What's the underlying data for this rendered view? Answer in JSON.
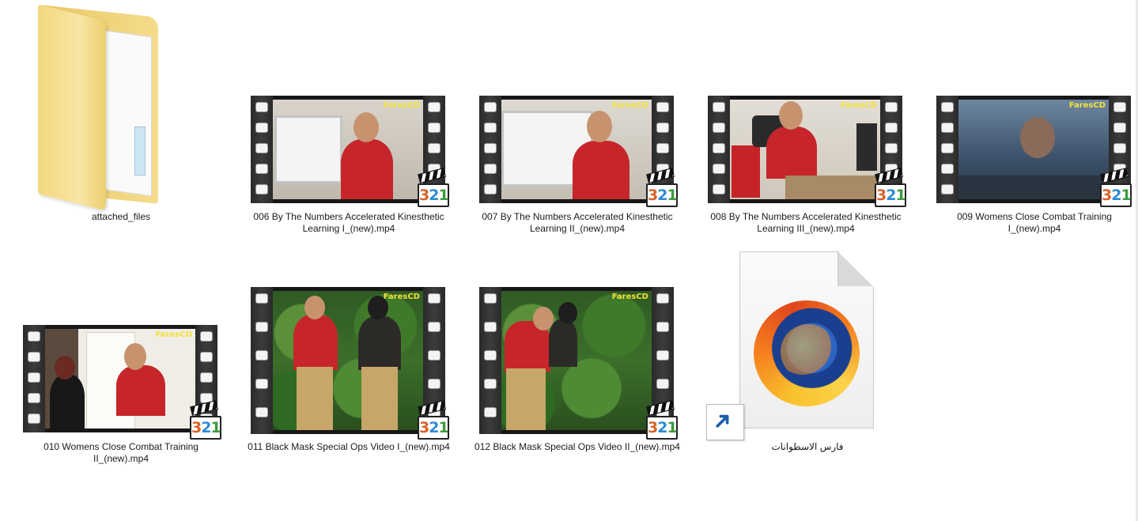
{
  "items": [
    {
      "type": "folder",
      "name": "attached_files"
    },
    {
      "type": "video",
      "name": "006 By The Numbers Accelerated Kinesthetic Learning I_(new).mp4",
      "line1": "006 By The Numbers Accelerated Kinesthetic",
      "line2": "Learning I_(new).mp4"
    },
    {
      "type": "video",
      "name": "007 By The Numbers Accelerated Kinesthetic Learning II_(new).mp4",
      "line1": "007 By The Numbers Accelerated Kinesthetic",
      "line2": "Learning II_(new).mp4"
    },
    {
      "type": "video",
      "name": "008 By The Numbers Accelerated Kinesthetic Learning III_(new).mp4",
      "line1": "008 By The Numbers Accelerated Kinesthetic",
      "line2": "Learning III_(new).mp4"
    },
    {
      "type": "video",
      "name": "009 Womens Close Combat Training I_(new).mp4",
      "line1": "009 Womens Close Combat Training",
      "line2": "I_(new).mp4"
    },
    {
      "type": "video",
      "name": "010 Womens Close Combat Training II_(new).mp4",
      "line1": "010 Womens Close Combat Training",
      "line2": "II_(new).mp4"
    },
    {
      "type": "video",
      "name": "011 Black Mask Special Ops Video I_(new).mp4",
      "line1": "011 Black Mask Special Ops Video I_(new).mp4"
    },
    {
      "type": "video",
      "name": "012 Black Mask Special Ops Video II_(new).mp4",
      "line1": "012 Black Mask Special Ops Video II_(new).mp4"
    },
    {
      "type": "shortcut",
      "name": "فارس الاسطوانات",
      "icon": "firefox-icon"
    }
  ],
  "thumb_brand": "FaresCD",
  "badge_digits": {
    "d1": "3",
    "d2": "2",
    "d3": "1"
  }
}
